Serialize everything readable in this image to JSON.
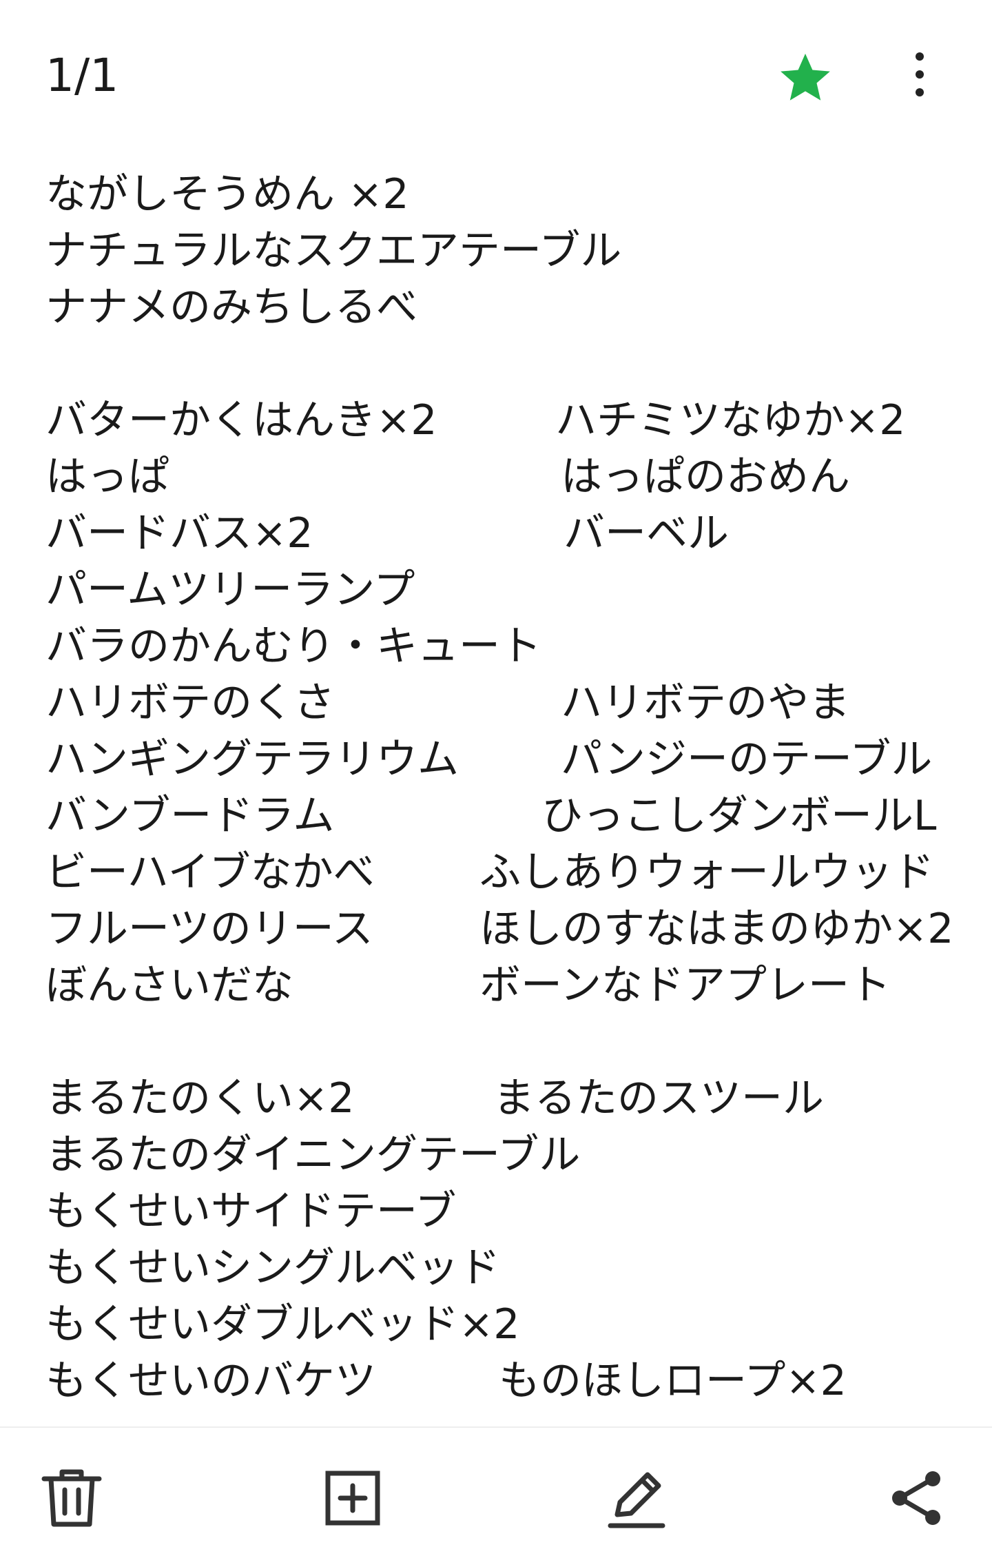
{
  "header": {
    "page_indicator": "1/1",
    "star_icon": "star-icon",
    "star_color": "#22b14c",
    "more_icon": "more-vertical-icon"
  },
  "note": {
    "lines": [
      {
        "left": "ながしそうめん ×2",
        "right": ""
      },
      {
        "left": "ナチュラルなスクエアテーブル",
        "right": ""
      },
      {
        "left": "ナナメのみちしるべ",
        "right": ""
      },
      {
        "left": "",
        "right": ""
      },
      {
        "left": "バターかくはんき×2",
        "right": "ハチミツなゆか×2"
      },
      {
        "left": "はっぱ",
        "right": "はっぱのおめん"
      },
      {
        "left": "バードバス×2",
        "right": "バーベル"
      },
      {
        "left": "パームツリーランプ",
        "right": ""
      },
      {
        "left": "バラのかんむり・キュート",
        "right": ""
      },
      {
        "left": "ハリボテのくさ",
        "right": "ハリボテのやま"
      },
      {
        "left": "ハンギングテラリウム",
        "right": "パンジーのテーブル"
      },
      {
        "left": "バンブードラム",
        "right": "ひっこしダンボールL"
      },
      {
        "left": "ビーハイブなかべ",
        "right": "ふしありウォールウッド"
      },
      {
        "left": "フルーツのリース",
        "right": "ほしのすなはまのゆか×2"
      },
      {
        "left": "ぼんさいだな",
        "right": "ボーンなドアプレート"
      },
      {
        "left": "",
        "right": ""
      },
      {
        "left": "まるたのくい×2",
        "right": "まるたのスツール"
      },
      {
        "left": "まるたのダイニングテーブル",
        "right": ""
      },
      {
        "left": "もくせいサイドテーブ",
        "right": ""
      },
      {
        "left": "もくせいシングルベッド",
        "right": ""
      },
      {
        "left": "もくせいダブルベッド×2",
        "right": ""
      },
      {
        "left": "もくせいのバケツ",
        "right": "ものほしロープ×2"
      }
    ]
  },
  "bottom_bar": {
    "delete_icon": "trash-icon",
    "add_icon": "add-box-icon",
    "edit_icon": "pencil-icon",
    "share_icon": "share-icon"
  }
}
